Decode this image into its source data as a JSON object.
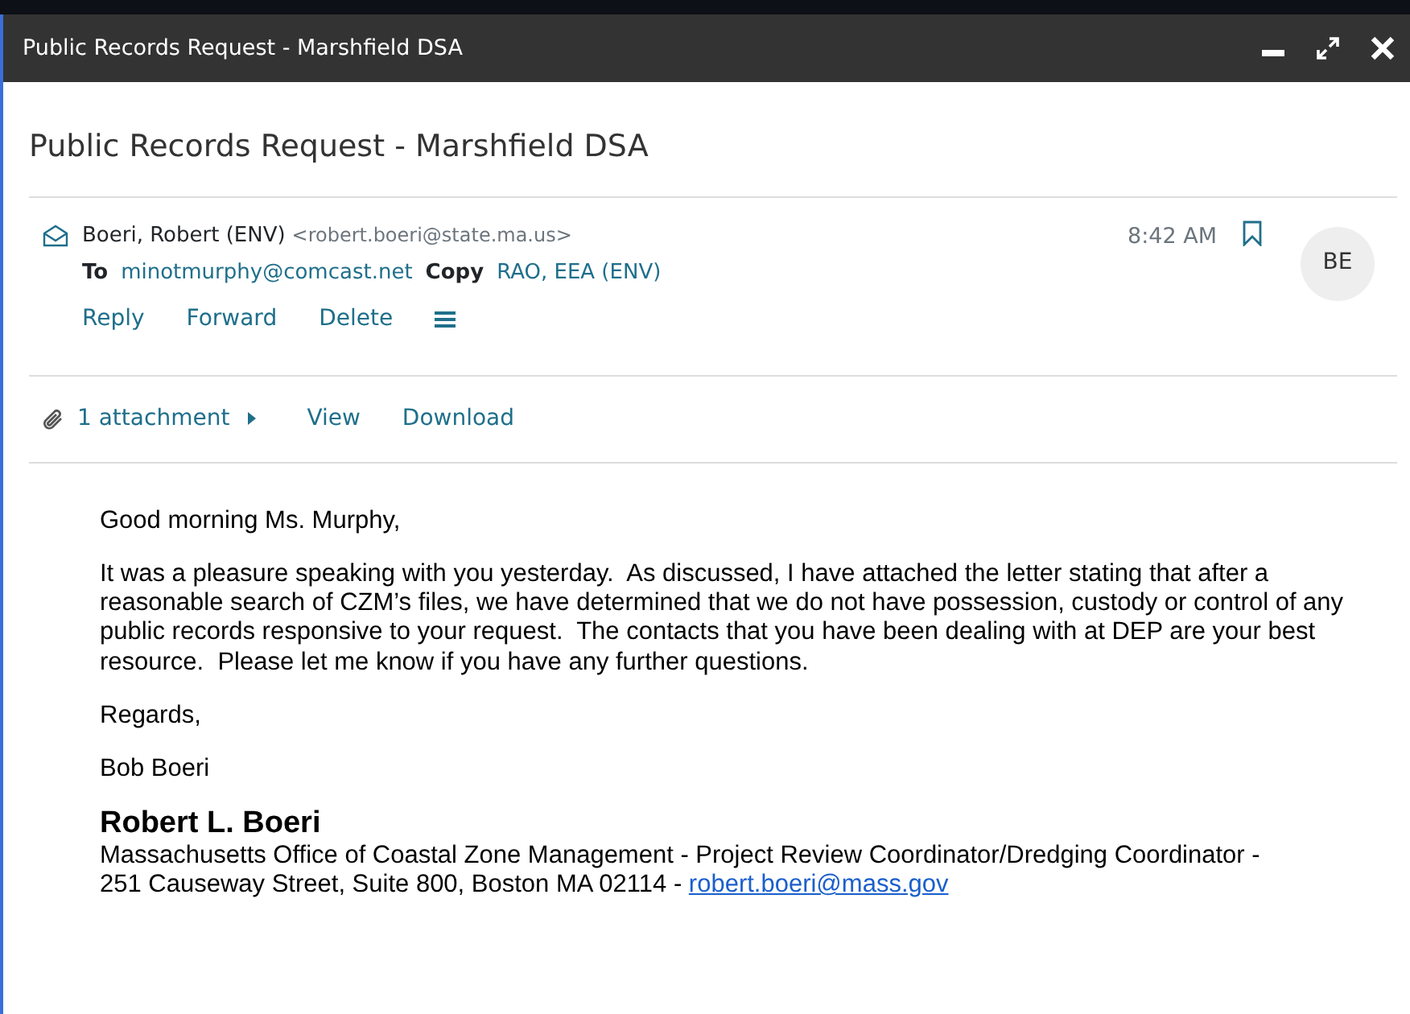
{
  "window": {
    "title": "Public Records Request - Marshfield DSA"
  },
  "subject": "Public Records Request - Marshfield DSA",
  "message": {
    "sender_name": "Boeri, Robert (ENV)",
    "sender_email": "<robert.boeri@state.ma.us>",
    "read": true,
    "to_label": "To",
    "to": "minotmurphy@comcast.net",
    "copy_label": "Copy",
    "copy": "RAO, EEA (ENV)",
    "time": "8:42 AM",
    "flagged": false,
    "avatar": "BE",
    "actions": [
      "Reply",
      "Forward",
      "Delete"
    ]
  },
  "attachments": {
    "count": "1 attachment",
    "expanded": false,
    "actions": [
      "View",
      "Download"
    ]
  },
  "body": {
    "paragraphs": [
      "Good morning Ms. Murphy,",
      "It was a pleasure speaking with you yesterday.  As discussed, I have attached the letter stating that after a reasonable search of CZM’s files, we have determined that we do not have possession, custody or control of any public records responsive to your request.  The contacts that you have been dealing with at DEP are your best resource.  Please let me know if you have any further questions.",
      "Regards,",
      "Bob Boeri"
    ],
    "signature": {
      "name": "Robert L. Boeri",
      "line1": "Massachusetts Office of Coastal Zone Management - Project Review Coordinator/Dredging Coordinator -",
      "line2": "251 Causeway Street, Suite 800, Boston MA 02114 - ",
      "email": "robert.boeri@mass.gov"
    }
  }
}
